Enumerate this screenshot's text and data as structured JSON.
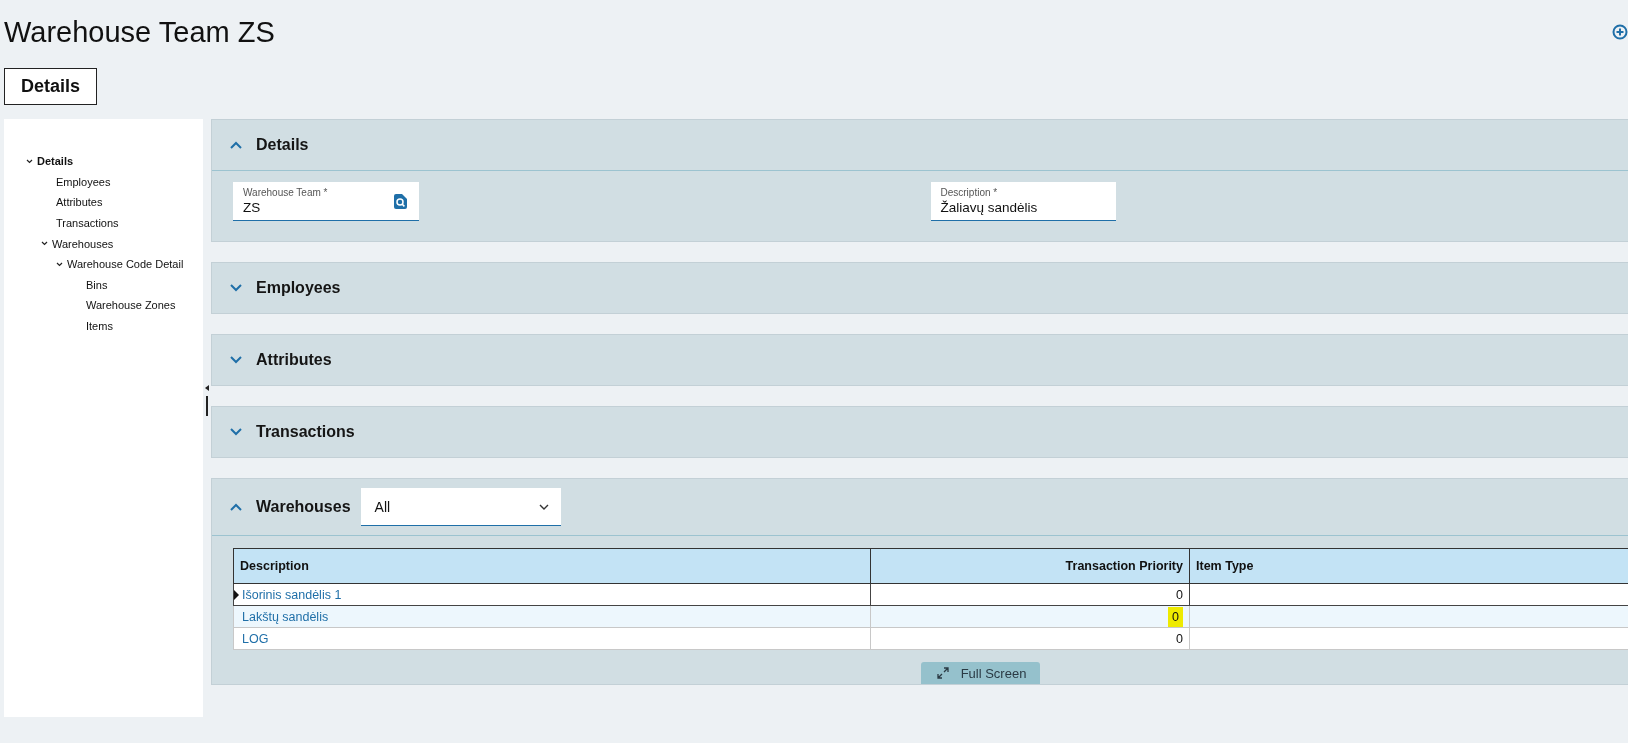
{
  "page": {
    "title": "Warehouse Team ZS"
  },
  "tabs": [
    {
      "label": "Details",
      "selected": true
    }
  ],
  "tree": [
    {
      "label": "Details",
      "expanded": true,
      "selected": true,
      "children": [
        {
          "label": "Employees"
        },
        {
          "label": "Attributes"
        },
        {
          "label": "Transactions"
        },
        {
          "label": "Warehouses",
          "expanded": true,
          "children": [
            {
              "label": "Warehouse Code Detail",
              "expanded": true,
              "children": [
                {
                  "label": "Bins"
                },
                {
                  "label": "Warehouse Zones"
                },
                {
                  "label": "Items"
                }
              ]
            }
          ]
        }
      ]
    }
  ],
  "sections": [
    {
      "kind": "fields",
      "title": "Details",
      "expanded": true,
      "fields": [
        {
          "kind": "lookup",
          "label": "Warehouse Team *",
          "value": "ZS"
        },
        {
          "kind": "text",
          "label": "Description *",
          "value": "Žaliavų sandėlis"
        }
      ]
    },
    {
      "kind": "plain",
      "title": "Employees",
      "expanded": false
    },
    {
      "kind": "plain",
      "title": "Attributes",
      "expanded": false
    },
    {
      "kind": "plain",
      "title": "Transactions",
      "expanded": false
    },
    {
      "kind": "table",
      "title": "Warehouses",
      "expanded": true,
      "filter": {
        "value": "All"
      },
      "columns": [
        "Description",
        "Transaction Priority",
        "Item Type"
      ],
      "rows": [
        {
          "selected": true,
          "description": "Išorinis sandėlis 1",
          "transaction_priority": "0",
          "highlighted": false
        },
        {
          "selected": false,
          "description": "Lakštų sandėlis",
          "transaction_priority": "0",
          "highlighted": true
        },
        {
          "selected": false,
          "description": "LOG",
          "transaction_priority": "0",
          "highlighted": false
        }
      ],
      "footer_button": "Full Screen"
    }
  ]
}
